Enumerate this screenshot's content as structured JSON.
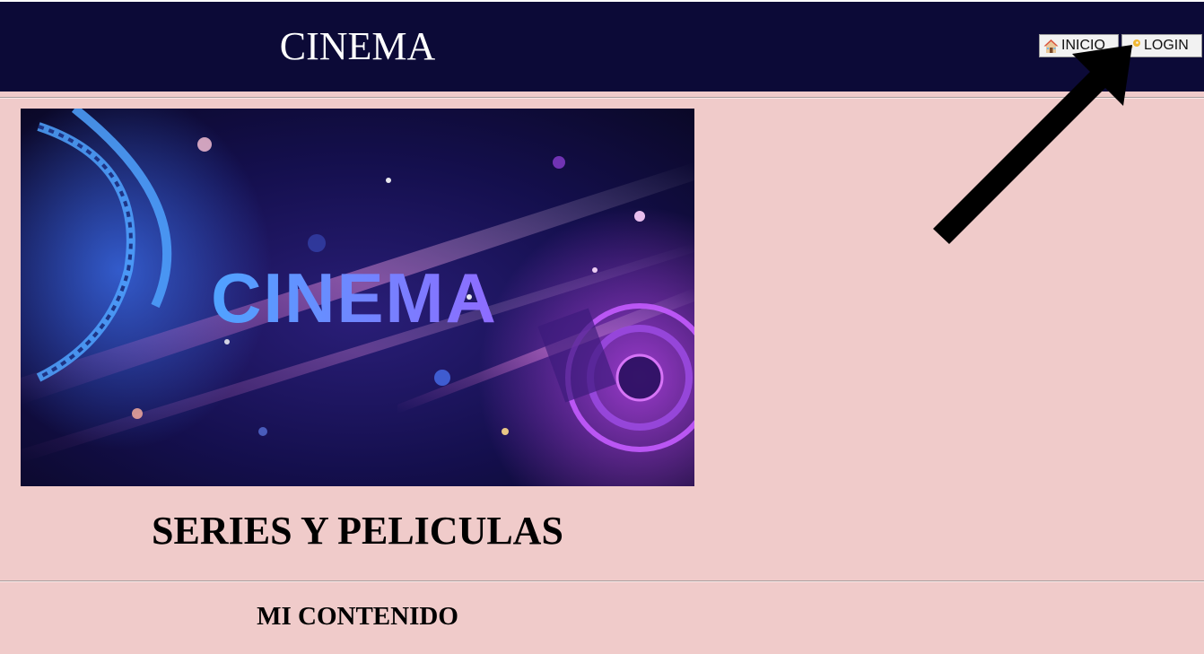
{
  "header": {
    "title": "CINEMA",
    "nav": [
      {
        "label": "INICIO",
        "icon": "house-icon"
      },
      {
        "label": "LOGIN",
        "icon": "key-icon"
      }
    ]
  },
  "hero": {
    "image_text": "CINEMA"
  },
  "main": {
    "heading": "SERIES Y PELICULAS",
    "section_title": "MI CONTENIDO"
  },
  "colors": {
    "header_bg": "#0c0a37",
    "page_bg": "#f0cbca",
    "hero_text": "#5b8cf2"
  }
}
